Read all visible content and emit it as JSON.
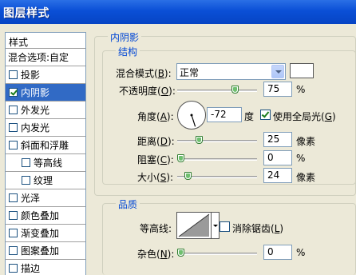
{
  "window": {
    "title": "图层样式"
  },
  "sidebar": {
    "header": "样式",
    "blend_options": "混合选项:自定",
    "items": [
      {
        "label": "投影",
        "checked": false,
        "sub": false,
        "selected": false
      },
      {
        "label": "内阴影",
        "checked": true,
        "sub": false,
        "selected": true
      },
      {
        "label": "外发光",
        "checked": false,
        "sub": false,
        "selected": false
      },
      {
        "label": "内发光",
        "checked": false,
        "sub": false,
        "selected": false
      },
      {
        "label": "斜面和浮雕",
        "checked": false,
        "sub": false,
        "selected": false
      },
      {
        "label": "等高线",
        "checked": false,
        "sub": true,
        "selected": false
      },
      {
        "label": "纹理",
        "checked": false,
        "sub": true,
        "selected": false
      },
      {
        "label": "光泽",
        "checked": false,
        "sub": false,
        "selected": false
      },
      {
        "label": "颜色叠加",
        "checked": false,
        "sub": false,
        "selected": false
      },
      {
        "label": "渐变叠加",
        "checked": false,
        "sub": false,
        "selected": false
      },
      {
        "label": "图案叠加",
        "checked": false,
        "sub": false,
        "selected": false
      },
      {
        "label": "描边",
        "checked": false,
        "sub": false,
        "selected": false
      }
    ]
  },
  "panel": {
    "title": "内阴影",
    "structure": {
      "legend": "结构",
      "blend_mode": {
        "label_pre": "混合模式(",
        "key": "B",
        "label_post": "):",
        "value": "正常",
        "color": "#ffffff"
      },
      "opacity": {
        "label_pre": "不透明度(",
        "key": "O",
        "label_post": "):",
        "value": "75",
        "unit": "%",
        "slider_fraction": 0.75
      },
      "angle": {
        "label_pre": "角度(",
        "key": "A",
        "label_post": "):",
        "value": "-72",
        "unit": "度",
        "degrees": -72
      },
      "global_light": {
        "label_pre": "使用全局光(",
        "key": "G",
        "label_post": ")",
        "checked": true
      },
      "distance": {
        "label_pre": "距离(",
        "key": "D",
        "label_post": "):",
        "value": "25",
        "unit": "像素",
        "slider_fraction": 0.25
      },
      "choke": {
        "label_pre": "阻塞(",
        "key": "C",
        "label_post": "):",
        "value": "0",
        "unit": "%",
        "slider_fraction": 0.0
      },
      "size": {
        "label_pre": "大小(",
        "key": "S",
        "label_post": "):",
        "value": "24",
        "unit": "像素",
        "slider_fraction": 0.1
      }
    },
    "quality": {
      "legend": "品质",
      "contour_label": "等高线:",
      "antialias": {
        "label_pre": "消除锯齿(",
        "key": "L",
        "label_post": ")",
        "checked": false
      },
      "noise": {
        "label_pre": "杂色(",
        "key": "N",
        "label_post": "):",
        "value": "0",
        "unit": "%",
        "slider_fraction": 0.0
      }
    }
  },
  "colors": {
    "title_bar": "#0a4fd6",
    "selection": "#316ac5",
    "legend_text": "#0046d5"
  }
}
